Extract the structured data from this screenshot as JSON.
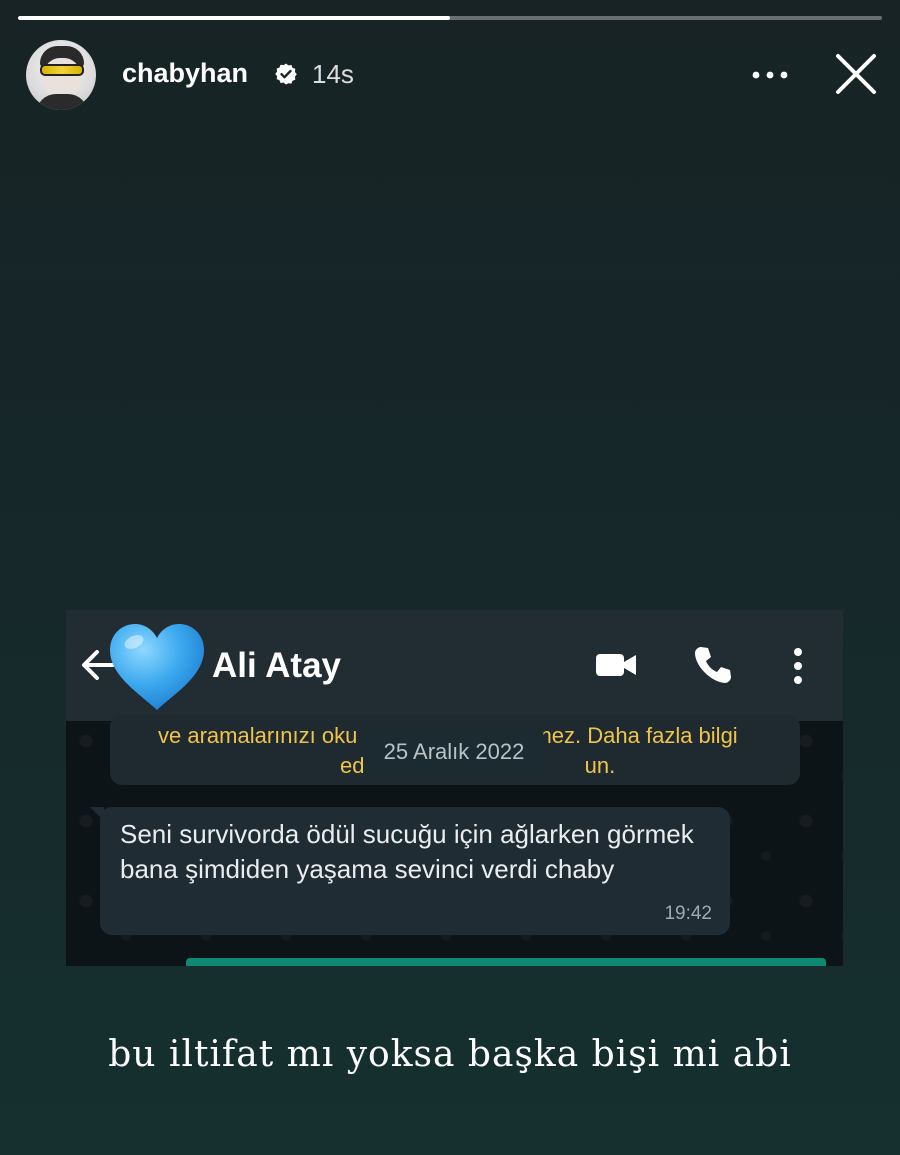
{
  "story": {
    "progress": 0.5,
    "username": "chabyhan",
    "time_ago": "14s"
  },
  "chat_screenshot": {
    "contact_name": "Ali Atay",
    "system_note_line1": "ve aramalarınızı oku                                        mez. Daha fazla bilgi",
    "system_note_line2": "ed                                                  un.",
    "date_chip": "25 Aralık 2022",
    "message_text": "Seni survivorda ödül sucuğu için ağlarken görmek bana şimdiden yaşama sevinci verdi chaby",
    "message_time": "19:42"
  },
  "caption": "bu iltifat mı yoksa başka bişi mi abi",
  "colors": {
    "background": "#172325",
    "whatsapp_header": "#222c33",
    "bubble": "#1f2c33",
    "system_note_text": "#f0c44c",
    "accent_green": "#0f8a72",
    "heart": "#3aa8ee"
  },
  "icons": [
    "verified-badge-icon",
    "more-options-icon",
    "close-icon",
    "back-arrow-icon",
    "blue-heart-icon",
    "video-call-icon",
    "phone-icon",
    "vertical-menu-icon"
  ]
}
